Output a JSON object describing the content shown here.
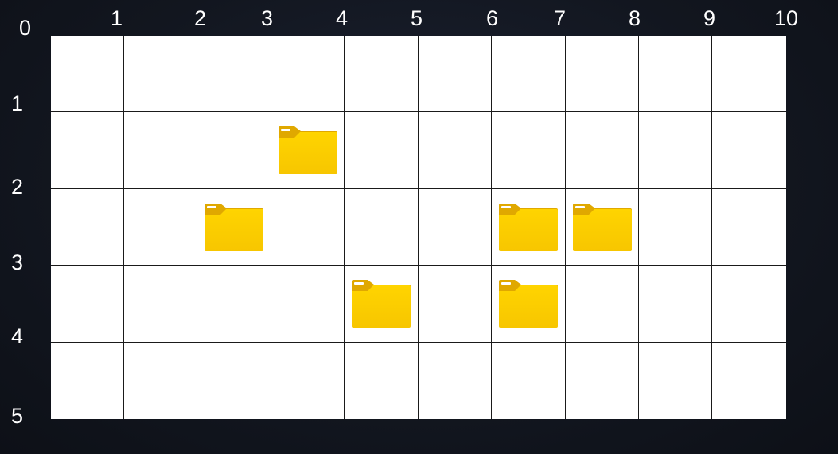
{
  "x_labels": [
    "0",
    "1",
    "2",
    "3",
    "4",
    "5",
    "6",
    "7",
    "8",
    "9",
    "10"
  ],
  "y_labels": [
    "1",
    "2",
    "3",
    "4",
    "5"
  ],
  "grid": {
    "columns": 10,
    "rows": 5
  },
  "folders": [
    {
      "col": 3,
      "row": 1,
      "icon": "folder-icon"
    },
    {
      "col": 2,
      "row": 2,
      "icon": "folder-icon"
    },
    {
      "col": 6,
      "row": 2,
      "icon": "folder-icon"
    },
    {
      "col": 7,
      "row": 2,
      "icon": "folder-icon"
    },
    {
      "col": 4,
      "row": 3,
      "icon": "folder-icon"
    },
    {
      "col": 6,
      "row": 3,
      "icon": "folder-icon"
    }
  ],
  "colors": {
    "folder_front": "#ffd000",
    "folder_back": "#e0a800",
    "grid_line": "#1a1a1a",
    "background": "#12161f"
  }
}
